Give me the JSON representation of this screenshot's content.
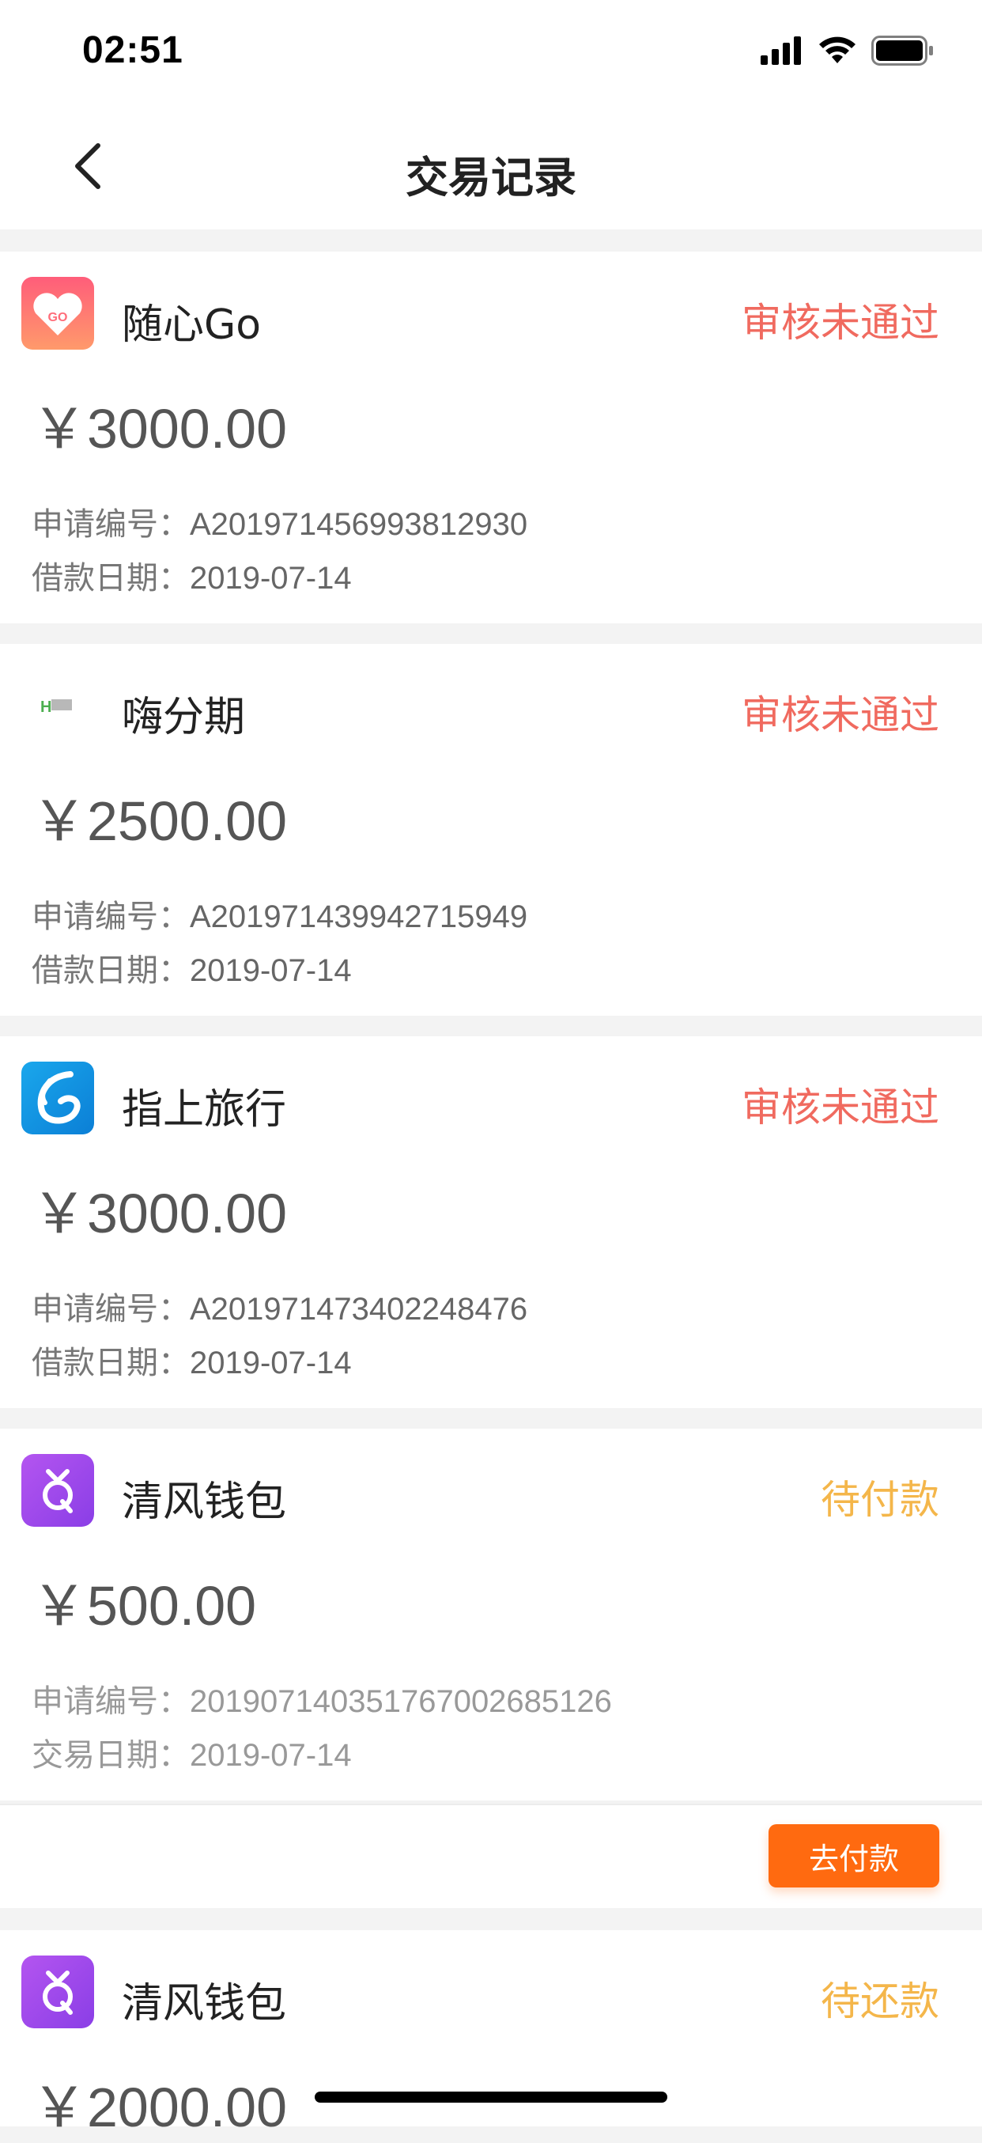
{
  "status_bar": {
    "time": "02:51"
  },
  "nav": {
    "title": "交易记录"
  },
  "records": [
    {
      "merchant": "随心Go",
      "logo_icon": "heart-tag-icon",
      "status": "审核未通过",
      "amount": "￥3000.00",
      "id_label": "申请编号：",
      "id_value": "A201971456993812930",
      "date_label": "借款日期：",
      "date_value": "2019-07-14"
    },
    {
      "merchant": "嗨分期",
      "logo_icon": "hi-fenqi-icon",
      "status": "审核未通过",
      "amount": "￥2500.00",
      "id_label": "申请编号：",
      "id_value": "A201971439942715949",
      "date_label": "借款日期：",
      "date_value": "2019-07-14"
    },
    {
      "merchant": "指上旅行",
      "logo_icon": "swirl-icon",
      "status": "审核未通过",
      "amount": "￥3000.00",
      "id_label": "申请编号：",
      "id_value": "A201971473402248476",
      "date_label": "借款日期：",
      "date_value": "2019-07-14"
    },
    {
      "merchant": "清风钱包",
      "logo_icon": "purple-q-icon",
      "status": "待付款",
      "amount": "￥500.00",
      "id_label": "申请编号：",
      "id_value": "20190714035176700268512​6",
      "date_label": "交易日期：",
      "date_value": "2019-07-14"
    },
    {
      "merchant": "清风钱包",
      "logo_icon": "purple-q-icon",
      "status": "待还款",
      "amount": "￥2000.00"
    }
  ],
  "action": {
    "pay_label": "去付款"
  },
  "colors": {
    "rejected": "#f06a5f",
    "pending": "#f4b64a",
    "pay_button": "#ff6a10"
  }
}
